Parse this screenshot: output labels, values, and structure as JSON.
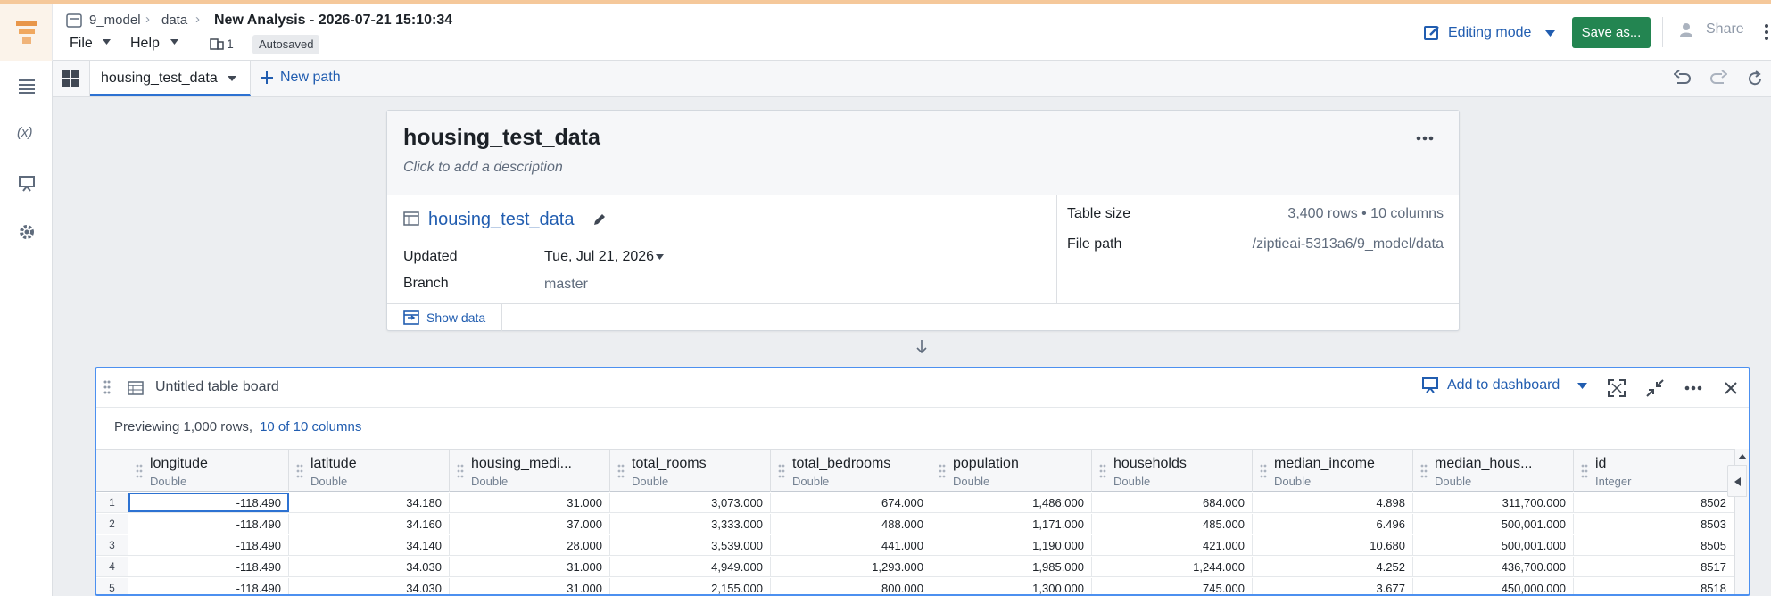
{
  "breadcrumb": {
    "folder": "9_model",
    "sub": "data",
    "title": "New Analysis - 2026-07-21 15:10:34"
  },
  "menus": {
    "file": "File",
    "help": "Help",
    "users_count": "1",
    "autosaved": "Autosaved"
  },
  "header_actions": {
    "editing_mode": "Editing mode",
    "save_as": "Save as...",
    "share": "Share"
  },
  "tabs": [
    {
      "label": "housing_test_data"
    }
  ],
  "new_path": "New path",
  "dataset_card": {
    "title": "housing_test_data",
    "description_placeholder": "Click to add a description",
    "dataset_name": "housing_test_data",
    "updated_label": "Updated",
    "updated_value": "Tue, Jul 21, 2026",
    "branch_label": "Branch",
    "branch_value": "master",
    "table_size_label": "Table size",
    "table_size_value": "3,400 rows • 10 columns",
    "file_path_label": "File path",
    "file_path_value": "/ziptieai-5313a6/9_model/data",
    "show_data": "Show data"
  },
  "board": {
    "title": "Untitled table board",
    "add_to_dashboard": "Add to dashboard",
    "preview_text": "Previewing 1,000 rows,",
    "columns_link": "10 of 10 columns",
    "columns": [
      {
        "name": "longitude",
        "type": "Double"
      },
      {
        "name": "latitude",
        "type": "Double"
      },
      {
        "name": "housing_medi...",
        "type": "Double"
      },
      {
        "name": "total_rooms",
        "type": "Double"
      },
      {
        "name": "total_bedrooms",
        "type": "Double"
      },
      {
        "name": "population",
        "type": "Double"
      },
      {
        "name": "households",
        "type": "Double"
      },
      {
        "name": "median_income",
        "type": "Double"
      },
      {
        "name": "median_hous...",
        "type": "Double"
      },
      {
        "name": "id",
        "type": "Integer"
      }
    ],
    "rows": [
      {
        "n": "1",
        "cells": [
          "-118.490",
          "34.180",
          "31.000",
          "3,073.000",
          "674.000",
          "1,486.000",
          "684.000",
          "4.898",
          "311,700.000",
          "8502"
        ]
      },
      {
        "n": "2",
        "cells": [
          "-118.490",
          "34.160",
          "37.000",
          "3,333.000",
          "488.000",
          "1,171.000",
          "485.000",
          "6.496",
          "500,001.000",
          "8503"
        ]
      },
      {
        "n": "3",
        "cells": [
          "-118.490",
          "34.140",
          "28.000",
          "3,539.000",
          "441.000",
          "1,190.000",
          "421.000",
          "10.680",
          "500,001.000",
          "8505"
        ]
      },
      {
        "n": "4",
        "cells": [
          "-118.490",
          "34.030",
          "31.000",
          "4,949.000",
          "1,293.000",
          "1,985.000",
          "1,244.000",
          "4.252",
          "436,700.000",
          "8517"
        ]
      },
      {
        "n": "5",
        "cells": [
          "-118.490",
          "34.030",
          "31.000",
          "2,155.000",
          "800.000",
          "1,300.000",
          "745.000",
          "3.677",
          "450,000.000",
          "8518"
        ]
      }
    ]
  }
}
